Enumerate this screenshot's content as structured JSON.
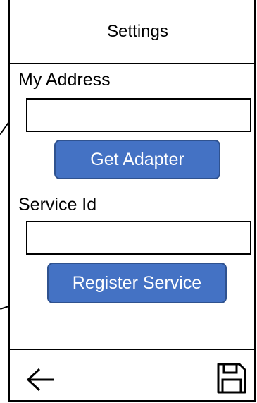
{
  "header": {
    "title": "Settings"
  },
  "address": {
    "label": "My Address",
    "value": "",
    "placeholder": ""
  },
  "get_adapter": {
    "label": "Get Adapter"
  },
  "service": {
    "label": "Service Id",
    "value": "",
    "placeholder": ""
  },
  "register_service": {
    "label": "Register Service"
  },
  "footer": {
    "back_icon": "arrow-left-icon",
    "save_icon": "floppy-disk-icon"
  },
  "colors": {
    "button_fill": "#4472c4",
    "button_border": "#2f528f",
    "button_text": "#ffffff",
    "line": "#000000"
  }
}
